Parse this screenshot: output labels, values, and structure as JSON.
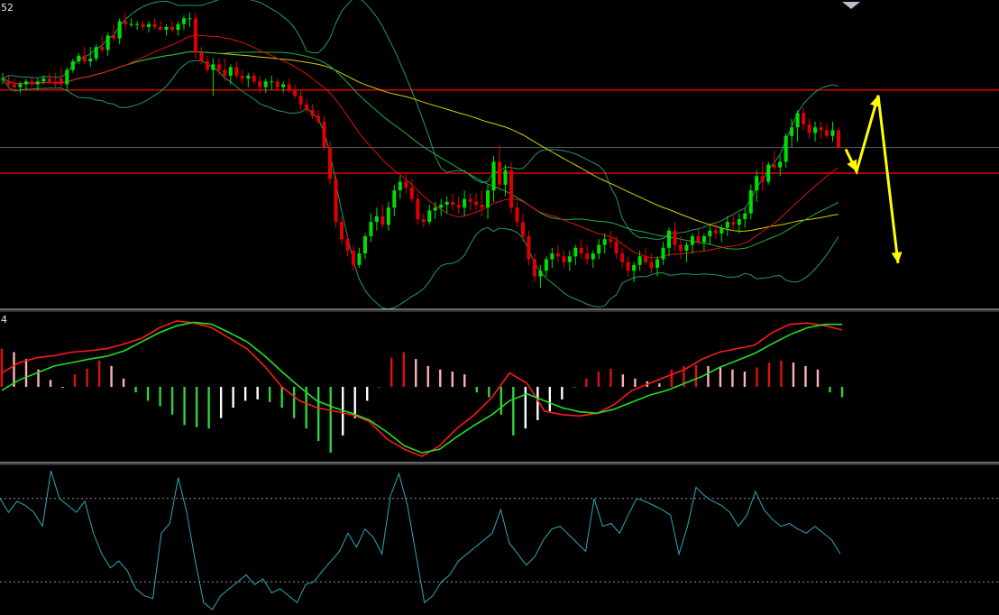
{
  "labels": {
    "price_panel_label": "52",
    "macd_panel_label": "4"
  },
  "colors": {
    "background": "#000000",
    "bull_candle": "#00e000",
    "bear_candle": "#e00000",
    "resistance_line": "#cc0000",
    "ma_yellow": "#d8d000",
    "ma_red": "#e01010",
    "ma_green": "#20b040",
    "bollinger": "#1f9a6a",
    "forecast_arrow": "#ffff00",
    "macd_line": "#ff1a1a",
    "signal_line": "#22e022",
    "hist_pos_red": "#e01010",
    "hist_pos_pink": "#ffb0b8",
    "hist_neg_green": "#30d040",
    "hist_neg_white": "#ffffff",
    "oscillator": "#2aaab8",
    "panel_divider": "#d0d0d0",
    "dotted_level": "#909090"
  },
  "chart_data": [
    {
      "type": "candlestick",
      "panel": "price",
      "ylim": [
        0,
        100
      ],
      "grid": false,
      "horizontal_levels": [
        {
          "name": "resistance",
          "value": 73
        },
        {
          "name": "current",
          "value": 53
        },
        {
          "name": "support",
          "value": 44
        }
      ],
      "ohlc": [
        [
          77,
          79,
          75,
          77
        ],
        [
          76,
          78,
          74,
          75
        ],
        [
          75,
          77,
          73,
          74
        ],
        [
          74,
          76,
          72,
          75
        ],
        [
          75,
          77,
          73,
          76
        ],
        [
          76,
          78,
          74,
          75
        ],
        [
          75,
          77,
          73,
          76
        ],
        [
          76,
          78,
          75,
          77
        ],
        [
          77,
          79,
          75,
          76
        ],
        [
          76,
          79,
          74,
          75
        ],
        [
          77,
          81,
          74,
          75
        ],
        [
          75,
          81,
          73,
          80
        ],
        [
          80,
          84,
          79,
          83
        ],
        [
          83,
          86,
          82,
          85
        ],
        [
          85,
          88,
          82,
          83
        ],
        [
          83,
          88,
          81,
          84
        ],
        [
          84,
          89,
          83,
          88
        ],
        [
          88,
          92,
          86,
          87
        ],
        [
          87,
          93,
          85,
          92
        ],
        [
          92,
          96,
          90,
          91
        ],
        [
          91,
          98,
          89,
          97
        ],
        [
          97,
          100,
          94,
          96
        ],
        [
          96,
          98,
          95,
          96
        ],
        [
          96,
          97,
          94,
          96
        ],
        [
          96,
          97,
          94,
          95
        ],
        [
          95,
          97,
          93,
          96
        ],
        [
          96,
          98,
          94,
          95
        ],
        [
          95,
          97,
          94,
          94
        ],
        [
          94,
          96,
          92,
          95
        ],
        [
          95,
          97,
          93,
          94
        ],
        [
          94,
          97,
          92,
          96
        ],
        [
          96,
          99,
          94,
          98
        ],
        [
          98,
          100,
          95,
          98
        ],
        [
          98,
          100,
          84,
          86
        ],
        [
          86,
          88,
          82,
          83
        ],
        [
          83,
          85,
          79,
          80
        ],
        [
          80,
          84,
          71,
          82
        ],
        [
          82,
          84,
          78,
          80
        ],
        [
          80,
          84,
          76,
          78
        ],
        [
          78,
          82,
          75,
          81
        ],
        [
          81,
          83,
          77,
          78
        ],
        [
          78,
          80,
          75,
          77
        ],
        [
          77,
          79,
          74,
          78
        ],
        [
          78,
          79,
          75,
          76
        ],
        [
          76,
          78,
          72,
          74
        ],
        [
          74,
          77,
          72,
          76
        ],
        [
          76,
          78,
          73,
          76
        ],
        [
          76,
          77,
          73,
          74
        ],
        [
          74,
          76,
          72,
          75
        ],
        [
          75,
          77,
          72,
          73
        ],
        [
          73,
          75,
          70,
          71
        ],
        [
          71,
          73,
          66,
          68
        ],
        [
          68,
          70,
          65,
          66
        ],
        [
          66,
          68,
          63,
          64
        ],
        [
          64,
          66,
          61,
          62
        ],
        [
          62,
          64,
          52,
          53
        ],
        [
          53,
          55,
          40,
          42
        ],
        [
          42,
          44,
          25,
          27
        ],
        [
          27,
          29,
          19,
          21
        ],
        [
          21,
          23,
          15,
          17
        ],
        [
          17,
          19,
          10,
          12
        ],
        [
          12,
          18,
          11,
          16
        ],
        [
          16,
          23,
          14,
          22
        ],
        [
          22,
          30,
          20,
          27
        ],
        [
          27,
          32,
          24,
          29
        ],
        [
          29,
          33,
          25,
          26
        ],
        [
          26,
          34,
          24,
          32
        ],
        [
          32,
          40,
          29,
          38
        ],
        [
          38,
          43,
          35,
          41
        ],
        [
          41,
          44,
          37,
          39
        ],
        [
          39,
          42,
          34,
          35
        ],
        [
          35,
          37,
          26,
          28
        ],
        [
          28,
          30,
          25,
          27
        ],
        [
          27,
          33,
          26,
          31
        ],
        [
          31,
          34,
          28,
          32
        ],
        [
          32,
          35,
          29,
          33
        ],
        [
          33,
          36,
          30,
          34
        ],
        [
          34,
          37,
          31,
          33
        ],
        [
          33,
          36,
          30,
          32
        ],
        [
          32,
          38,
          29,
          35
        ],
        [
          35,
          37,
          31,
          34
        ],
        [
          34,
          37,
          31,
          33
        ],
        [
          33,
          38,
          29,
          32
        ],
        [
          32,
          40,
          28,
          38
        ],
        [
          38,
          50,
          34,
          48
        ],
        [
          48,
          54,
          38,
          40
        ],
        [
          40,
          47,
          36,
          45
        ],
        [
          45,
          48,
          30,
          32
        ],
        [
          32,
          34,
          25,
          27
        ],
        [
          27,
          30,
          20,
          22
        ],
        [
          22,
          24,
          12,
          14
        ],
        [
          14,
          16,
          6,
          8
        ],
        [
          8,
          12,
          4,
          10
        ],
        [
          10,
          15,
          8,
          14
        ],
        [
          14,
          18,
          11,
          16
        ],
        [
          16,
          19,
          13,
          15
        ],
        [
          15,
          17,
          11,
          13
        ],
        [
          13,
          17,
          10,
          15
        ],
        [
          15,
          19,
          12,
          18
        ],
        [
          18,
          21,
          14,
          16
        ],
        [
          16,
          19,
          12,
          14
        ],
        [
          14,
          17,
          11,
          16
        ],
        [
          16,
          21,
          14,
          19
        ],
        [
          19,
          23,
          16,
          21
        ],
        [
          21,
          24,
          18,
          20
        ],
        [
          20,
          22,
          14,
          16
        ],
        [
          16,
          18,
          11,
          13
        ],
        [
          13,
          15,
          8,
          10
        ],
        [
          10,
          13,
          6,
          12
        ],
        [
          12,
          17,
          10,
          15
        ],
        [
          15,
          18,
          12,
          13
        ],
        [
          13,
          16,
          9,
          11
        ],
        [
          11,
          15,
          8,
          14
        ],
        [
          14,
          20,
          12,
          18
        ],
        [
          18,
          25,
          15,
          24
        ],
        [
          24,
          27,
          17,
          19
        ],
        [
          19,
          22,
          14,
          17
        ],
        [
          17,
          20,
          13,
          19
        ],
        [
          19,
          23,
          16,
          22
        ],
        [
          22,
          25,
          19,
          20
        ],
        [
          20,
          23,
          17,
          22
        ],
        [
          22,
          26,
          19,
          24
        ],
        [
          24,
          27,
          21,
          23
        ],
        [
          23,
          26,
          20,
          25
        ],
        [
          25,
          29,
          22,
          27
        ],
        [
          27,
          30,
          24,
          26
        ],
        [
          26,
          30,
          23,
          28
        ],
        [
          28,
          32,
          25,
          30
        ],
        [
          30,
          40,
          28,
          38
        ],
        [
          38,
          45,
          34,
          43
        ],
        [
          43,
          48,
          38,
          41
        ],
        [
          41,
          48,
          40,
          47
        ],
        [
          47,
          52,
          45,
          46
        ],
        [
          46,
          50,
          43,
          48
        ],
        [
          48,
          58,
          46,
          57
        ],
        [
          57,
          63,
          53,
          60
        ],
        [
          60,
          66,
          55,
          65
        ],
        [
          65,
          67,
          59,
          61
        ],
        [
          61,
          63,
          56,
          58
        ],
        [
          58,
          62,
          55,
          60
        ],
        [
          60,
          62,
          56,
          59
        ],
        [
          59,
          61,
          56,
          57
        ],
        [
          57,
          62,
          55,
          59
        ],
        [
          59,
          60,
          53,
          53
        ]
      ]
    },
    {
      "type": "line",
      "panel": "MACD",
      "ylim": [
        -100,
        100
      ],
      "series": [
        {
          "key": "macd",
          "values": [
            20,
            35,
            42,
            45,
            50,
            52,
            55,
            62,
            70,
            85,
            95,
            92,
            85,
            70,
            55,
            30,
            0,
            -20,
            -30,
            -35,
            -40,
            -50,
            -75,
            -90,
            -100,
            -85,
            -60,
            -40,
            -15,
            20,
            5,
            -35,
            -40,
            -42,
            -38,
            -25,
            -5,
            5,
            15,
            25,
            40,
            50,
            55,
            60,
            78,
            90,
            92,
            88,
            82
          ]
        },
        {
          "key": "signal",
          "values": [
            -5,
            10,
            20,
            30,
            35,
            40,
            44,
            52,
            65,
            78,
            88,
            93,
            90,
            78,
            65,
            45,
            22,
            0,
            -20,
            -30,
            -38,
            -48,
            -65,
            -85,
            -95,
            -90,
            -72,
            -55,
            -40,
            -20,
            -10,
            -20,
            -30,
            -36,
            -38,
            -32,
            -22,
            -12,
            -5,
            5,
            15,
            28,
            38,
            48,
            62,
            75,
            85,
            90,
            90
          ]
        },
        {
          "key": "histogram",
          "values": [
            55,
            50,
            40,
            25,
            10,
            0,
            18,
            26,
            38,
            30,
            12,
            -8,
            -20,
            -28,
            -40,
            -55,
            -58,
            -60,
            -45,
            -30,
            -20,
            -18,
            -22,
            -30,
            -45,
            -60,
            -78,
            -95,
            -70,
            -45,
            -20,
            0,
            42,
            50,
            40,
            30,
            25,
            22,
            18,
            -8,
            -15,
            -40,
            -70,
            -60,
            -48,
            -35,
            -18,
            0,
            12,
            22,
            26,
            18,
            12,
            8,
            5,
            25,
            30,
            32,
            30,
            28,
            25,
            22,
            28,
            35,
            38,
            35,
            30,
            25,
            -8,
            -15
          ]
        }
      ]
    },
    {
      "type": "line",
      "panel": "oscillator",
      "ylim": [
        0,
        100
      ],
      "dotted_levels": [
        80,
        20
      ],
      "series": [
        {
          "key": "oscillator",
          "values": [
            80,
            70,
            78,
            75,
            70,
            60,
            100,
            80,
            75,
            70,
            78,
            55,
            40,
            30,
            35,
            28,
            15,
            10,
            8,
            55,
            62,
            95,
            70,
            35,
            5,
            0,
            10,
            15,
            20,
            25,
            18,
            22,
            12,
            15,
            10,
            5,
            18,
            20,
            28,
            35,
            42,
            55,
            45,
            58,
            52,
            40,
            82,
            98,
            75,
            40,
            5,
            10,
            20,
            25,
            35,
            40,
            45,
            50,
            55,
            72,
            48,
            40,
            32,
            38,
            50,
            58,
            60,
            54,
            48,
            42,
            80,
            60,
            62,
            55,
            68,
            80,
            78,
            75,
            72,
            68,
            40,
            60,
            88,
            82,
            78,
            75,
            70,
            60,
            68,
            85,
            72,
            65,
            60,
            62,
            58,
            55,
            60,
            55,
            50,
            40
          ]
        }
      ]
    }
  ]
}
